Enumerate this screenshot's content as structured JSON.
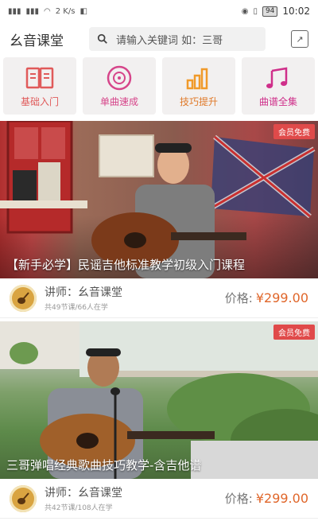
{
  "status_bar": {
    "left_icons": [
      "📶",
      "⁴⁶",
      "📶",
      "⁴⁶",
      "📶"
    ],
    "net_speed": "2 K/s",
    "battery": "94",
    "time": "10:02"
  },
  "header": {
    "title": "幺音课堂",
    "search_placeholder": "请输入关键词 如：三哥"
  },
  "categories": [
    {
      "label": "基础入门",
      "icon": "book-icon"
    },
    {
      "label": "单曲速成",
      "icon": "disc-icon"
    },
    {
      "label": "技巧提升",
      "icon": "bars-icon"
    },
    {
      "label": "曲谱全集",
      "icon": "music-note-icon"
    }
  ],
  "courses": [
    {
      "badge": "会员免费",
      "title": "【新手必学】民谣吉他标准教学初级入门课程",
      "teacher_label": "讲师：",
      "teacher": "幺音课堂",
      "meta": "共49节课/66人在学",
      "price_label": "价格:",
      "price": "¥299.00"
    },
    {
      "badge": "会员免费",
      "title": "三哥弹唱经典歌曲技巧教学-含吉他谱",
      "teacher_label": "讲师：",
      "teacher": "幺音课堂",
      "meta": "共42节课/108人在学",
      "price_label": "价格:",
      "price": "¥299.00"
    }
  ],
  "colors": {
    "accent": "#e0662a",
    "category_icon": "#e05a5a",
    "badge": "#e04a4a"
  }
}
